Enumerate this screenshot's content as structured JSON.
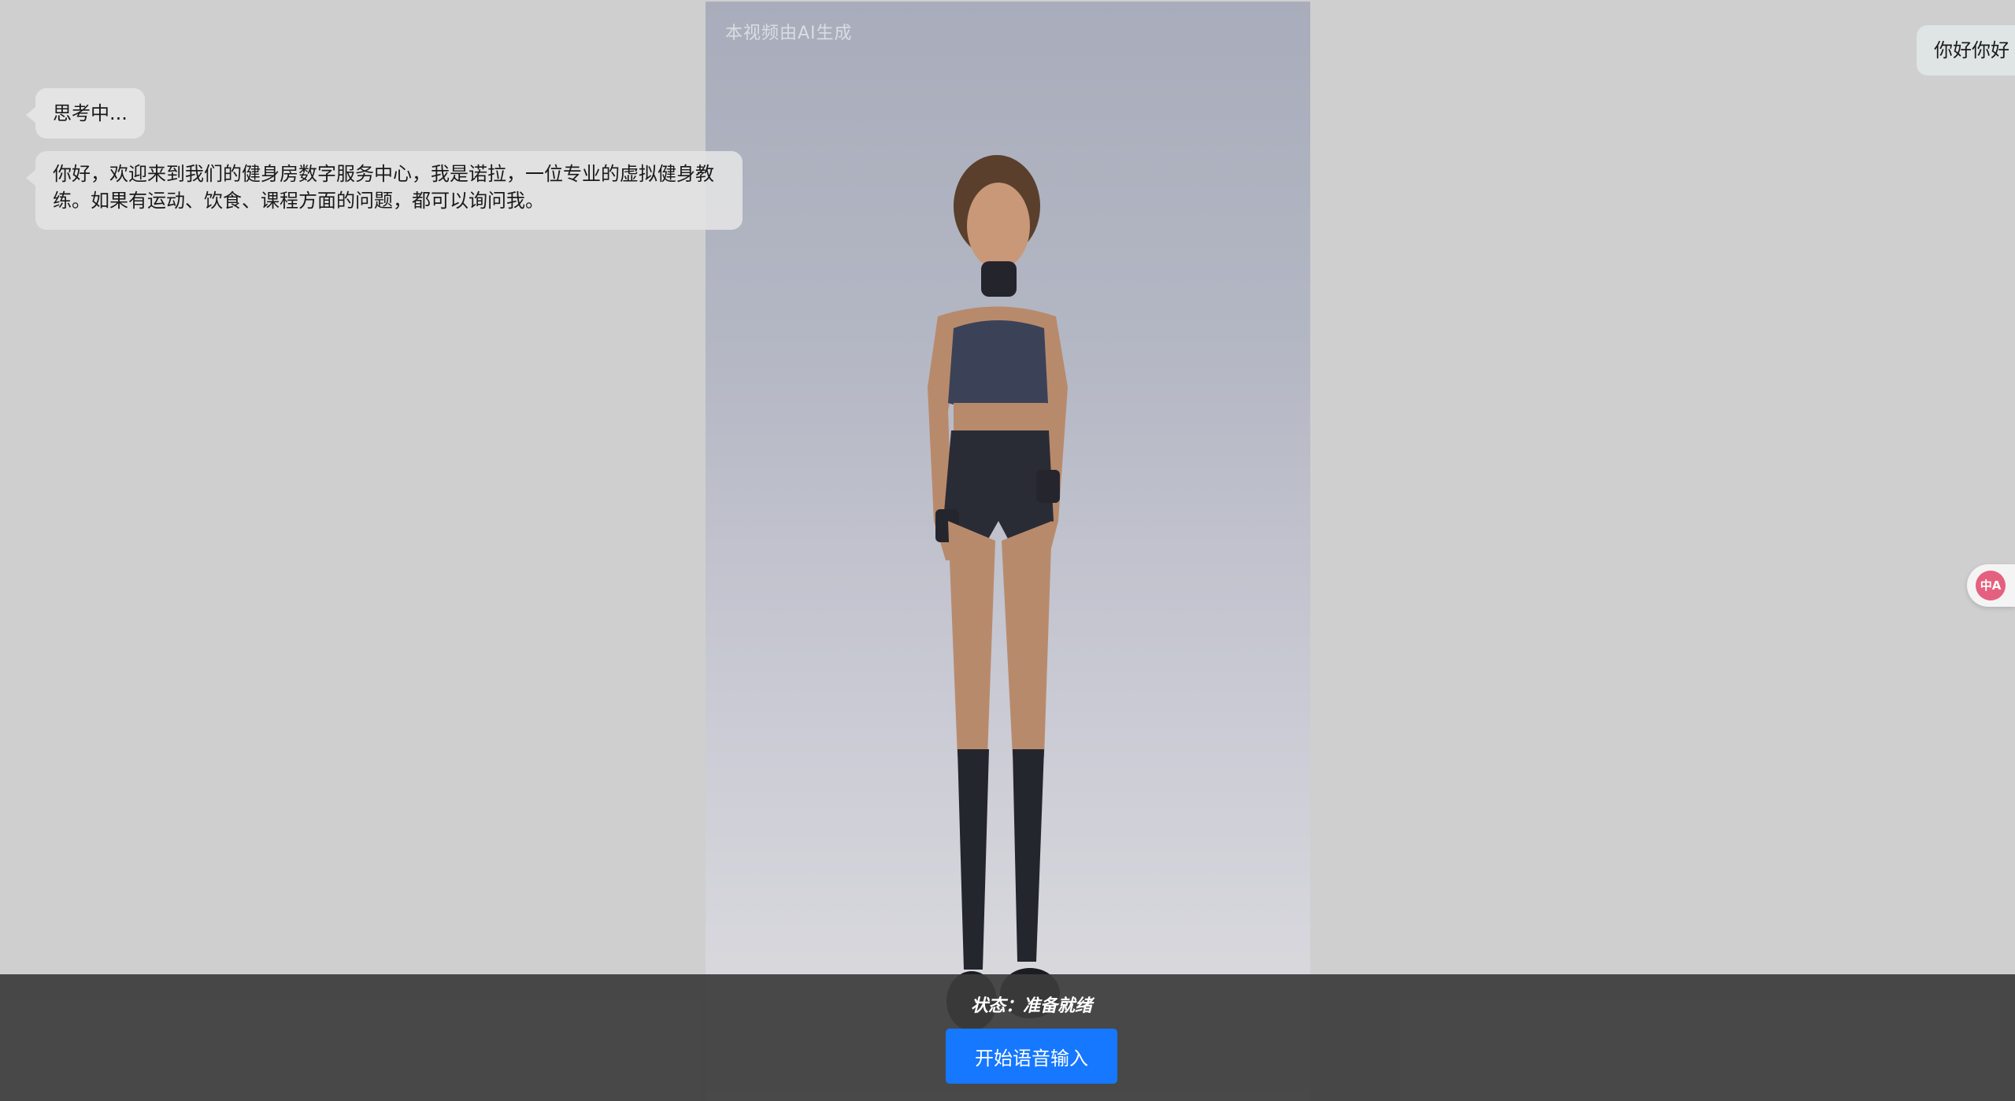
{
  "video": {
    "watermark": "本视频由AI生成"
  },
  "chat": {
    "thinking_text": "思考中...",
    "assistant_greeting": "你好，欢迎来到我们的健身房数字服务中心，我是诺拉，一位专业的虚拟健身教练。如果有运动、饮食、课程方面的问题，都可以询问我。",
    "user_message": "你好你好"
  },
  "translate": {
    "icon_text": "中A"
  },
  "controls": {
    "status_text": "状态：准备就绪",
    "voice_button_label": "开始语音输入"
  },
  "colors": {
    "page_background": "#cfcfcf",
    "bubble_background": "#e4e4e4",
    "bottom_bar": "#3c3c3c",
    "accent_button": "#1677ff",
    "translate_icon": "#e5607f"
  }
}
